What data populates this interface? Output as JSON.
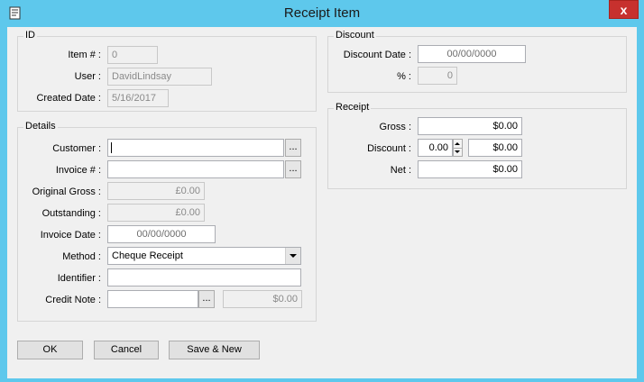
{
  "window": {
    "title": "Receipt Item",
    "close_label": "x"
  },
  "id_group": {
    "legend": "ID",
    "item_no_label": "Item # :",
    "item_no_value": "0",
    "user_label": "User :",
    "user_value": "DavidLindsay",
    "created_label": "Created Date :",
    "created_value": "5/16/2017"
  },
  "details_group": {
    "legend": "Details",
    "customer_label": "Customer :",
    "customer_value": "",
    "invoice_label": "Invoice # :",
    "invoice_value": "",
    "original_gross_label": "Original Gross :",
    "original_gross_value": "£0.00",
    "outstanding_label": "Outstanding :",
    "outstanding_value": "£0.00",
    "invoice_date_label": "Invoice Date :",
    "invoice_date_value": "00/00/0000",
    "method_label": "Method :",
    "method_value": "Cheque Receipt",
    "identifier_label": "Identifier :",
    "identifier_value": "",
    "credit_note_label": "Credit Note :",
    "credit_note_value": "",
    "credit_note_amount": "$0.00",
    "ellipsis": "..."
  },
  "discount_group": {
    "legend": "Discount",
    "date_label": "Discount Date :",
    "date_value": "00/00/0000",
    "percent_label": "% :",
    "percent_value": "0"
  },
  "receipt_group": {
    "legend": "Receipt",
    "gross_label": "Gross :",
    "gross_value": "$0.00",
    "discount_label": "Discount :",
    "discount_rate": "0.00",
    "discount_value": "$0.00",
    "net_label": "Net :",
    "net_value": "$0.00"
  },
  "buttons": {
    "ok": "OK",
    "cancel": "Cancel",
    "save_new": "Save & New"
  }
}
